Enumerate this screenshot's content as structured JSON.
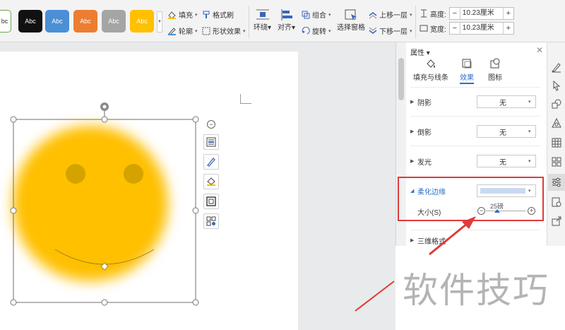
{
  "toolbar": {
    "style_swatches": [
      {
        "label": "bc",
        "color": "#ffffff"
      },
      {
        "label": "Abc",
        "color": "#111111"
      },
      {
        "label": "Abc",
        "color": "#4b8fd6"
      },
      {
        "label": "Abc",
        "color": "#ed7d31"
      },
      {
        "label": "Abc",
        "color": "#a5a5a5"
      },
      {
        "label": "Abc",
        "color": "#ffc000"
      }
    ],
    "fill": "填充",
    "format_painter": "格式刷",
    "outline": "轮廓",
    "shape_effects": "形状效果",
    "wrap": "环绕",
    "align": "对齐",
    "group": "组合",
    "rotate": "旋转",
    "selection_pane": "选择窗格",
    "bring_forward": "上移一层",
    "send_backward": "下移一层",
    "height_label": "高度:",
    "height_value": "10.23厘米",
    "width_label": "宽度:",
    "width_value": "10.23厘米",
    "minus": "−",
    "plus": "+"
  },
  "smiley": {
    "face_color": "#ffc000",
    "eye_color": "#d4a300"
  },
  "float_tools": {
    "collapse": "−"
  },
  "panel": {
    "title": "属性",
    "close": "✕",
    "tabs": [
      "填充与线条",
      "效果",
      "图标"
    ],
    "rows": [
      {
        "label": "阴影",
        "value": "无"
      },
      {
        "label": "倒影",
        "value": "无"
      },
      {
        "label": "发光",
        "value": "无"
      }
    ],
    "soft_edges": {
      "label": "柔化边缘",
      "size_label": "大小(S)",
      "size_value": "25磅",
      "minus": "−",
      "plus": "+",
      "size_level_pt": 25,
      "swatch_color": "#c9d9f2"
    },
    "next_section": "三维格式"
  },
  "watermark": "软件技巧",
  "colors": {
    "highlight": "#e03a3a",
    "accent": "#2a6fc9",
    "arrow": "#e03a3a"
  }
}
